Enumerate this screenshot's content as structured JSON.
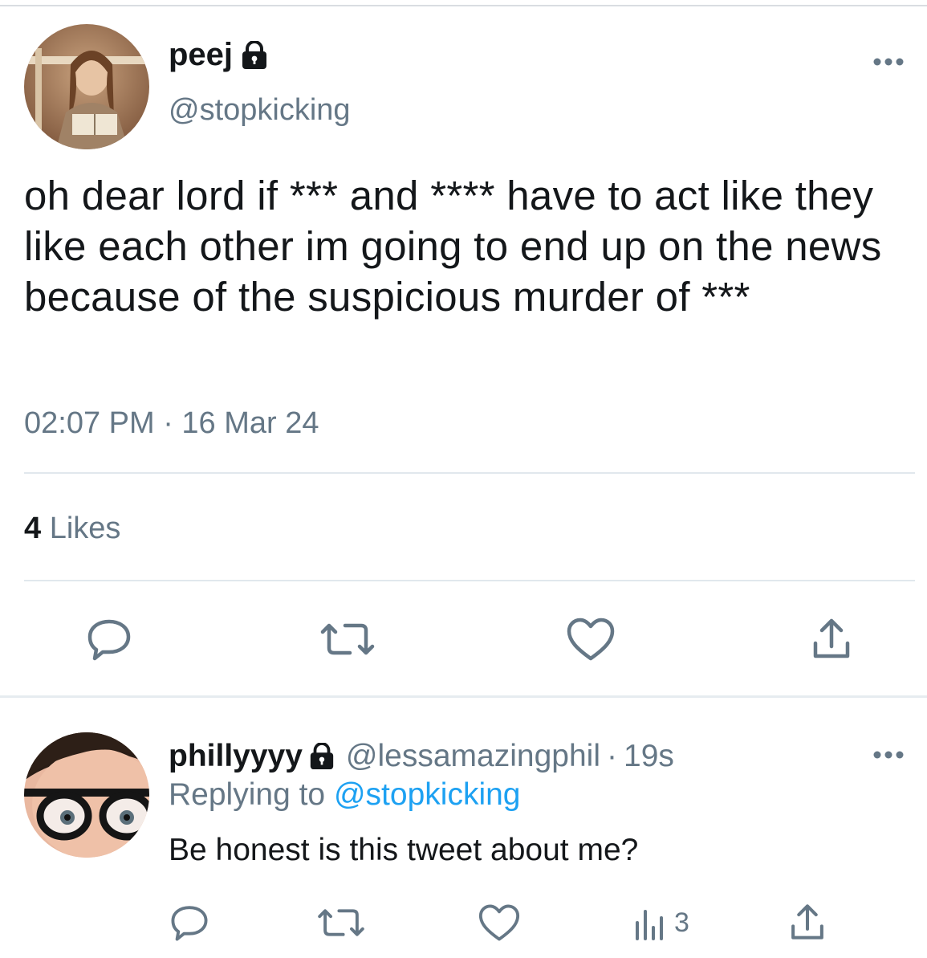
{
  "main_tweet": {
    "display_name": "peej",
    "handle": "@stopkicking",
    "text": "oh dear lord if *** and **** have to act like they like each other im going to end up on the news because of the suspicious murder of ***",
    "timestamp": "02:07 PM · 16 Mar 24",
    "likes_count": "4",
    "likes_label": "Likes",
    "icons": [
      "lock-icon",
      "more-icon",
      "reply-icon",
      "retweet-icon",
      "like-icon",
      "share-icon"
    ]
  },
  "reply": {
    "display_name": "phillyyyy",
    "handle": "@lessamazingphil",
    "dot": "·",
    "time_ago": "19s",
    "replying_prefix": "Replying to",
    "replying_handle": "@stopkicking",
    "text": "Be honest is this tweet about me?",
    "views_count": "3",
    "icons": [
      "lock-icon",
      "more-icon",
      "reply-icon",
      "retweet-icon",
      "like-icon",
      "views-icon",
      "share-icon"
    ]
  },
  "colors": {
    "text_primary": "#14171a",
    "text_secondary": "#657786",
    "link": "#1da1f2",
    "icon": "#657786",
    "divider": "#e1e8ed"
  }
}
